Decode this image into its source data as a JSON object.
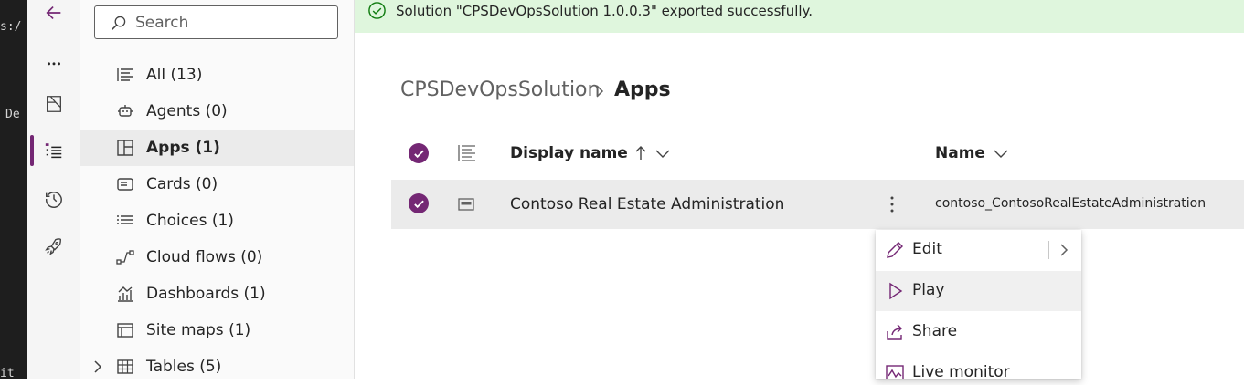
{
  "banner": {
    "message": "Solution \"CPSDevOpsSolution 1.0.0.3\" exported successfully."
  },
  "editor_strip": {
    "lines": [
      "s:/",
      "De",
      "it"
    ]
  },
  "search": {
    "placeholder": "Search"
  },
  "nav": {
    "items": [
      {
        "label": "All  (13)",
        "icon": "list-icon"
      },
      {
        "label": "Agents  (0)",
        "icon": "bot-icon"
      },
      {
        "label": "Apps  (1)",
        "icon": "app-layout-icon",
        "selected": true
      },
      {
        "label": "Cards  (0)",
        "icon": "card-icon"
      },
      {
        "label": "Choices  (1)",
        "icon": "choices-list-icon"
      },
      {
        "label": "Cloud flows  (0)",
        "icon": "flow-icon"
      },
      {
        "label": "Dashboards  (1)",
        "icon": "dashboard-icon"
      },
      {
        "label": "Site maps  (1)",
        "icon": "site-map-icon"
      },
      {
        "label": "Tables  (5)",
        "icon": "table-icon",
        "expandable": true
      }
    ]
  },
  "breadcrumb": {
    "root": "CPSDevOpsSolution",
    "current": "Apps"
  },
  "grid": {
    "columns": {
      "display_name": "Display name",
      "name": "Name"
    },
    "rows": [
      {
        "display_name": "Contoso Real Estate Administration",
        "name": "contoso_ContosoRealEstateAdministration",
        "selected": true
      }
    ]
  },
  "context_menu": {
    "items": [
      "Edit",
      "Play",
      "Share",
      "Live monitor"
    ],
    "hovered": "Play"
  },
  "colors": {
    "accent": "#742774",
    "banner_bg": "#dff6dd",
    "success": "#107c10"
  }
}
